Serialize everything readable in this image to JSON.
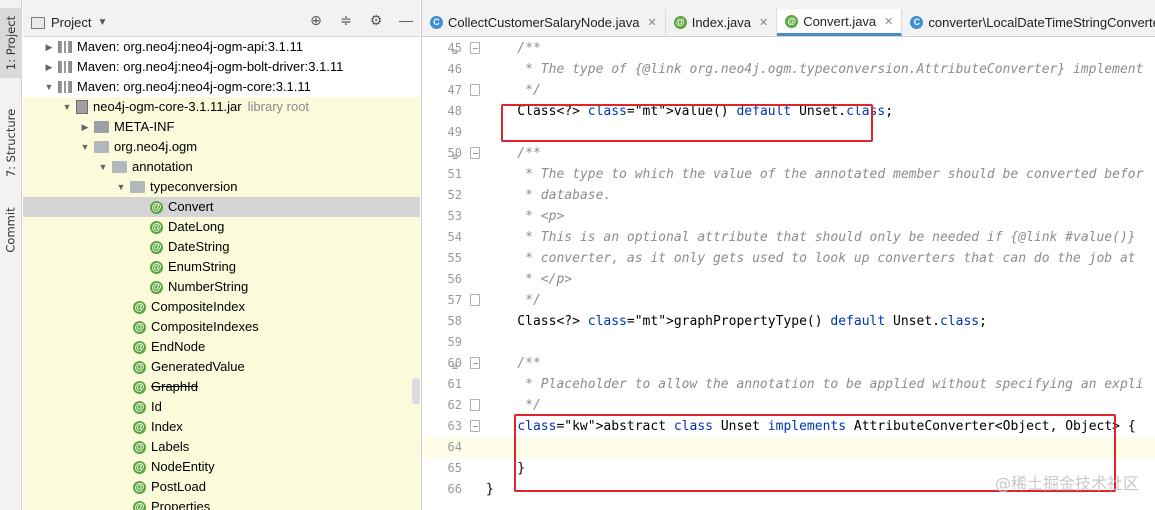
{
  "toolstrip": {
    "items": [
      {
        "label": "1: Project"
      },
      {
        "label": "7: Structure"
      },
      {
        "label": "Commit"
      }
    ]
  },
  "project": {
    "title": "Project",
    "tree": [
      {
        "label": "Maven: org.neo4j:neo4j-ogm-api:3.1.11",
        "icon": "maven-icon"
      },
      {
        "label": "Maven: org.neo4j:neo4j-ogm-bolt-driver:3.1.11",
        "icon": "maven-icon"
      },
      {
        "label": "Maven: org.neo4j:neo4j-ogm-core:3.1.11",
        "icon": "maven-icon"
      },
      {
        "label": "neo4j-ogm-core-3.1.11.jar",
        "suffix": "library root",
        "icon": "jar-icon"
      },
      {
        "label": "META-INF",
        "icon": "folder-icon"
      },
      {
        "label": "org.neo4j.ogm",
        "icon": "package-icon"
      },
      {
        "label": "annotation",
        "icon": "package-icon"
      },
      {
        "label": "typeconversion",
        "icon": "package-icon"
      },
      {
        "label": "Convert",
        "icon": "annotation-icon"
      },
      {
        "label": "DateLong",
        "icon": "annotation-icon"
      },
      {
        "label": "DateString",
        "icon": "annotation-icon"
      },
      {
        "label": "EnumString",
        "icon": "annotation-icon"
      },
      {
        "label": "NumberString",
        "icon": "annotation-icon"
      },
      {
        "label": "CompositeIndex",
        "icon": "annotation-icon"
      },
      {
        "label": "CompositeIndexes",
        "icon": "annotation-icon"
      },
      {
        "label": "EndNode",
        "icon": "annotation-icon"
      },
      {
        "label": "GeneratedValue",
        "icon": "annotation-icon"
      },
      {
        "label": "GraphId",
        "icon": "annotation-icon"
      },
      {
        "label": "Id",
        "icon": "annotation-icon"
      },
      {
        "label": "Index",
        "icon": "annotation-icon"
      },
      {
        "label": "Labels",
        "icon": "annotation-icon"
      },
      {
        "label": "NodeEntity",
        "icon": "annotation-icon"
      },
      {
        "label": "PostLoad",
        "icon": "annotation-icon"
      },
      {
        "label": "Properties",
        "icon": "annotation-icon"
      }
    ]
  },
  "editor": {
    "tabs": [
      {
        "label": "CollectCustomerSalaryNode.java"
      },
      {
        "label": "Index.java"
      },
      {
        "label": "Convert.java"
      },
      {
        "label": "converter\\LocalDateTimeStringConverter."
      }
    ],
    "lines": [
      {
        "n": "45",
        "t": "    /**"
      },
      {
        "n": "46",
        "t": "     * The type of {@link org.neo4j.ogm.typeconversion.AttributeConverter} implement"
      },
      {
        "n": "47",
        "t": "     */"
      },
      {
        "n": "48",
        "t": "    Class<?> value() default Unset.class;"
      },
      {
        "n": "49",
        "t": ""
      },
      {
        "n": "50",
        "t": "    /**"
      },
      {
        "n": "51",
        "t": "     * The type to which the value of the annotated member should be converted befor"
      },
      {
        "n": "52",
        "t": "     * database."
      },
      {
        "n": "53",
        "t": "     * <p>"
      },
      {
        "n": "54",
        "t": "     * This is an optional attribute that should only be needed if {@link #value()}"
      },
      {
        "n": "55",
        "t": "     * converter, as it only gets used to look up converters that can do the job at"
      },
      {
        "n": "56",
        "t": "     * </p>"
      },
      {
        "n": "57",
        "t": "     */"
      },
      {
        "n": "58",
        "t": "    Class<?> graphPropertyType() default Unset.class;"
      },
      {
        "n": "59",
        "t": ""
      },
      {
        "n": "60",
        "t": "    /**"
      },
      {
        "n": "61",
        "t": "     * Placeholder to allow the annotation to be applied without specifying an expli"
      },
      {
        "n": "62",
        "t": "     */"
      },
      {
        "n": "63",
        "t": "    abstract class Unset implements AttributeConverter<Object, Object> {"
      },
      {
        "n": "64",
        "t": ""
      },
      {
        "n": "65",
        "t": "    }"
      },
      {
        "n": "66",
        "t": "}"
      }
    ]
  },
  "watermark": "@稀土掘金技术社区",
  "colors": {
    "highlight_box": "#e0242b",
    "tab_active_underline": "#4a88c7",
    "library_bg": "#fbfbdc"
  }
}
